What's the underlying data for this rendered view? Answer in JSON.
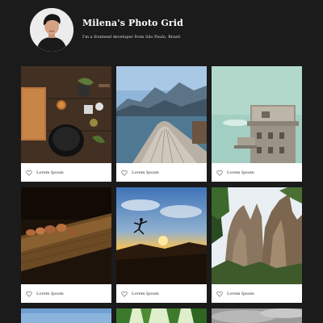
{
  "header": {
    "title": "Milena's Photo Grid",
    "subtitle": "I'm a frontend developer from São Paulo, Brazil"
  },
  "photos": [
    {
      "caption": "Lorem Ipsum",
      "subject": "spices and kitchen tools on dark wooden table"
    },
    {
      "caption": "Lorem Ipsum",
      "subject": "wooden boat bow on mountain lake"
    },
    {
      "caption": "Lorem Ipsum",
      "subject": "concrete tower against pale sky"
    },
    {
      "caption": "Lorem Ipsum",
      "subject": "row of small stones on wooden plank"
    },
    {
      "caption": "Lorem Ipsum",
      "subject": "person jumping at sunset"
    },
    {
      "caption": "Lorem Ipsum",
      "subject": "rocky cliffs with trees"
    },
    {
      "caption": "",
      "subject": "blue sky"
    },
    {
      "caption": "",
      "subject": "green forest canopy"
    },
    {
      "caption": "",
      "subject": "grey cloudy sky"
    }
  ],
  "icons": {
    "like": "heart-outline-icon"
  },
  "colors": {
    "background": "#1b1b1b",
    "card": "#ffffff",
    "title": "#ffffff"
  }
}
